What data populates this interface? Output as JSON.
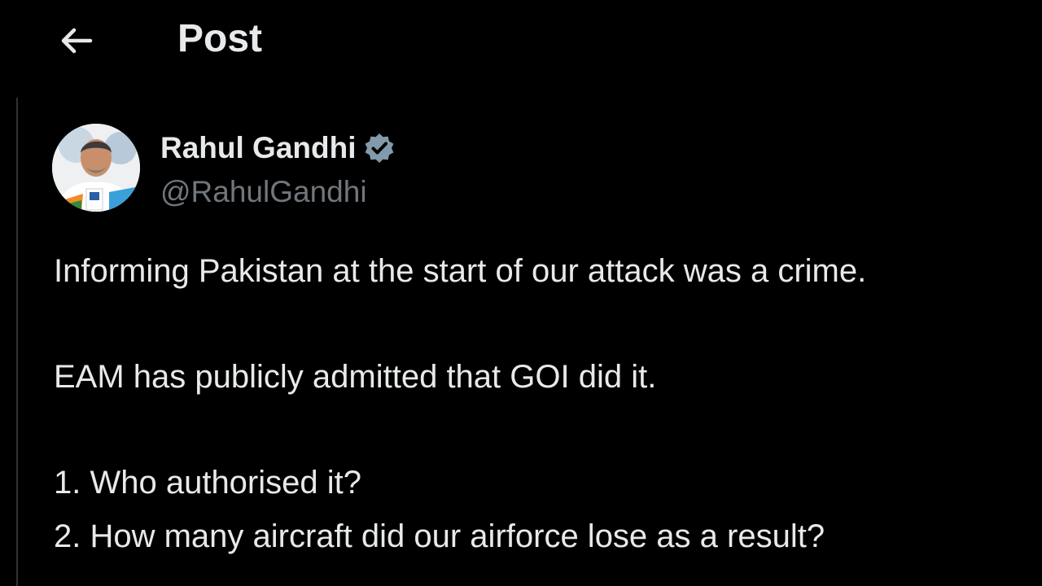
{
  "header": {
    "back_icon": "arrow-left-icon",
    "title": "Post"
  },
  "author": {
    "name": "Rahul Gandhi",
    "handle": "@RahulGandhi",
    "verified_icon": "verified-badge-icon",
    "verified_color": "#829aab"
  },
  "post": {
    "paragraphs": [
      "Informing Pakistan at the start of our attack was a crime.",
      "EAM has publicly admitted that GOI did it.",
      "1. Who authorised it?",
      "2. How many aircraft did our airforce lose as a result?"
    ]
  },
  "colors": {
    "background": "#000000",
    "text_primary": "#e7e9ea",
    "text_secondary": "#71767b"
  }
}
